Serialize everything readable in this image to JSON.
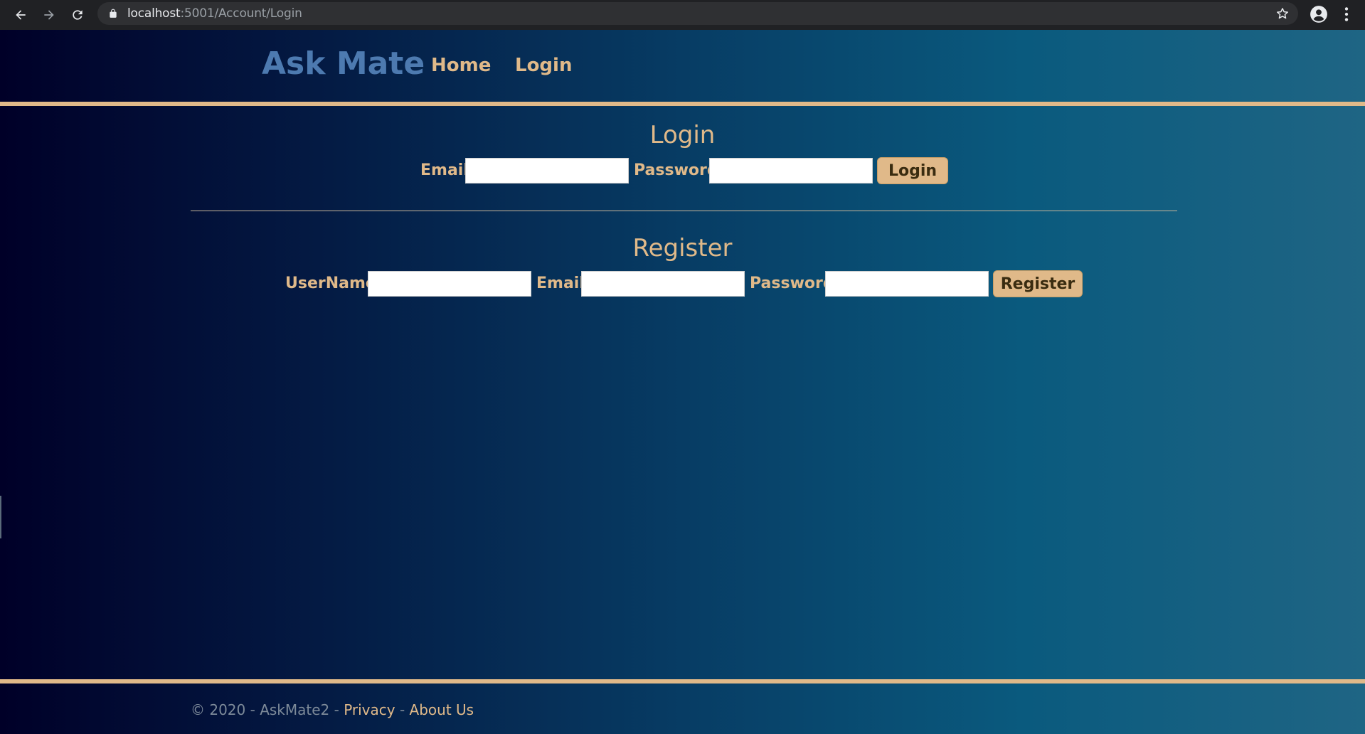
{
  "browser": {
    "url_host": "localhost",
    "url_rest": ":5001/Account/Login"
  },
  "header": {
    "brand": "Ask Mate",
    "nav": {
      "home": "Home",
      "login": "Login"
    }
  },
  "login_form": {
    "title": "Login",
    "email_label": "Email",
    "email_value": "",
    "password_label": "Password",
    "password_value": "",
    "submit_label": "Login"
  },
  "register_form": {
    "title": "Register",
    "username_label": "UserName",
    "username_value": "",
    "email_label": "Email",
    "email_value": "",
    "password_label": "Password",
    "password_value": "",
    "submit_label": "Register"
  },
  "footer": {
    "copyright": "© 2020 - AskMate2 - ",
    "privacy": "Privacy",
    "separator": " - ",
    "about": "About Us"
  },
  "colors": {
    "accent": "#e0b989",
    "brand": "#4d7ab0",
    "background_start": "#000028",
    "background_end": "#1f6584"
  },
  "icons": {
    "back": "arrow-left-icon",
    "forward": "arrow-right-icon",
    "reload": "reload-icon",
    "lock": "lock-icon",
    "bookmark": "star-icon",
    "profile": "account-circle-icon",
    "menu": "kebab-menu-icon"
  }
}
